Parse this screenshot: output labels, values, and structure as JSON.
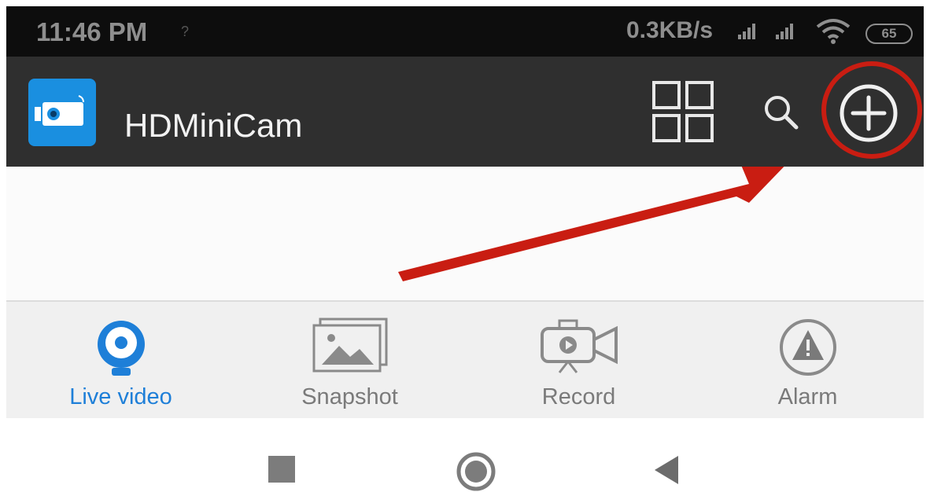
{
  "status_bar": {
    "time": "11:46 PM",
    "network_hint": "?",
    "speed": "0.3KB/s",
    "battery": "65",
    "icons": [
      "signal-icon",
      "signal-icon",
      "wifi-icon",
      "battery-icon"
    ]
  },
  "app_bar": {
    "title": "HDMiniCam",
    "icons": [
      "app-logo-icon",
      "grid-view-icon",
      "search-icon",
      "add-device-icon"
    ],
    "highlight_color": "#c91d12"
  },
  "tabs": [
    {
      "label": "Live video",
      "icon": "live-video-icon",
      "active": true
    },
    {
      "label": "Snapshot",
      "icon": "snapshot-icon",
      "active": false
    },
    {
      "label": "Record",
      "icon": "record-icon",
      "active": false
    },
    {
      "label": "Alarm",
      "icon": "alarm-icon",
      "active": false
    }
  ],
  "nav_bar": {
    "icons": [
      "recents-icon",
      "home-icon",
      "back-icon"
    ]
  },
  "colors": {
    "accent": "#1e7fd8",
    "app_bar_bg": "#2f2f2f",
    "annotation": "#c91d12"
  }
}
